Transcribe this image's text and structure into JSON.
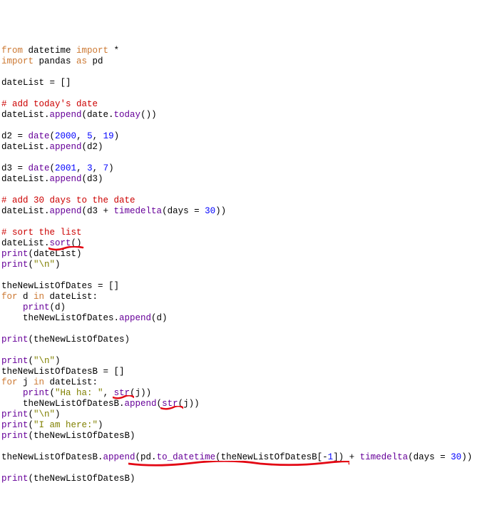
{
  "code": {
    "l01_from": "from",
    "l01_mod": " datetime ",
    "l01_import": "import",
    "l01_star": " *",
    "l02_import": "import",
    "l02_rest": " pandas ",
    "l02_as": "as",
    "l02_pd": " pd",
    "l04": "dateList = []",
    "l06_cmt": "# add today's date",
    "l07a": "dateList.",
    "l07_fn1": "append",
    "l07b": "(date.",
    "l07_fn2": "today",
    "l07c": "())",
    "l09a": "d2 = ",
    "l09_fn": "date",
    "l09b": "(",
    "l09_n1": "2000",
    "l09c": ", ",
    "l09_n2": "5",
    "l09d": ", ",
    "l09_n3": "19",
    "l09e": ")",
    "l10a": "dateList.",
    "l10_fn": "append",
    "l10b": "(d2)",
    "l12a": "d3 = ",
    "l12_fn": "date",
    "l12b": "(",
    "l12_n1": "2001",
    "l12c": ", ",
    "l12_n2": "3",
    "l12d": ", ",
    "l12_n3": "7",
    "l12e": ")",
    "l13a": "dateList.",
    "l13_fn": "append",
    "l13b": "(d3)",
    "l15_cmt": "# add 30 days to the date",
    "l16a": "dateList.",
    "l16_fn": "append",
    "l16b": "(d3 + ",
    "l16_fn2": "timedelta",
    "l16c": "(days = ",
    "l16_n": "30",
    "l16d": "))",
    "l18_cmt": "# sort the list",
    "l19a": "dateList.",
    "l19_fn": "sort",
    "l19b": "()",
    "l20_fn": "print",
    "l20a": "(dateList)",
    "l21_fn": "print",
    "l21a": "(",
    "l21_str": "\"\\n\"",
    "l21b": ")",
    "l23": "theNewListOfDates = []",
    "l24_for": "for",
    "l24a": " d ",
    "l24_in": "in",
    "l24b": " dateList:",
    "l25_ind": "    ",
    "l25_fn": "print",
    "l25a": "(d)",
    "l26_ind": "    theNewListOfDates.",
    "l26_fn": "append",
    "l26a": "(d)",
    "l28_fn": "print",
    "l28a": "(theNewListOfDates)",
    "l30_fn": "print",
    "l30a": "(",
    "l30_str": "\"\\n\"",
    "l30b": ")",
    "l31": "theNewListOfDatesB = []",
    "l32_for": "for",
    "l32a": " j ",
    "l32_in": "in",
    "l32b": " dateList:",
    "l33_ind": "    ",
    "l33_fn": "print",
    "l33a": "(",
    "l33_str": "\"Ha ha: \"",
    "l33b": ", ",
    "l33_fn2": "str",
    "l33c": "(j))",
    "l34_ind": "    theNewListOfDatesB.",
    "l34_fn": "append",
    "l34a": "(",
    "l34_fn2": "str",
    "l34b": "(j))",
    "l35_fn": "print",
    "l35a": "(",
    "l35_str": "\"\\n\"",
    "l35b": ")",
    "l36_fn": "print",
    "l36a": "(",
    "l36_str": "\"I am here:\"",
    "l36b": ")",
    "l37_fn": "print",
    "l37a": "(theNewListOfDatesB)",
    "l39a": "theNewListOfDatesB.",
    "l39_fn": "append",
    "l39b": "(pd.",
    "l39_fn2": "to_datetime",
    "l39c": "(theNewListOfDatesB[-",
    "l39_n": "1",
    "l39d": "]) + ",
    "l39_fn3": "timedelta",
    "l39e": "(days = ",
    "l39_n2": "30",
    "l39f": "))",
    "l41_fn": "print",
    "l41a": "(theNewListOfDatesB)"
  }
}
